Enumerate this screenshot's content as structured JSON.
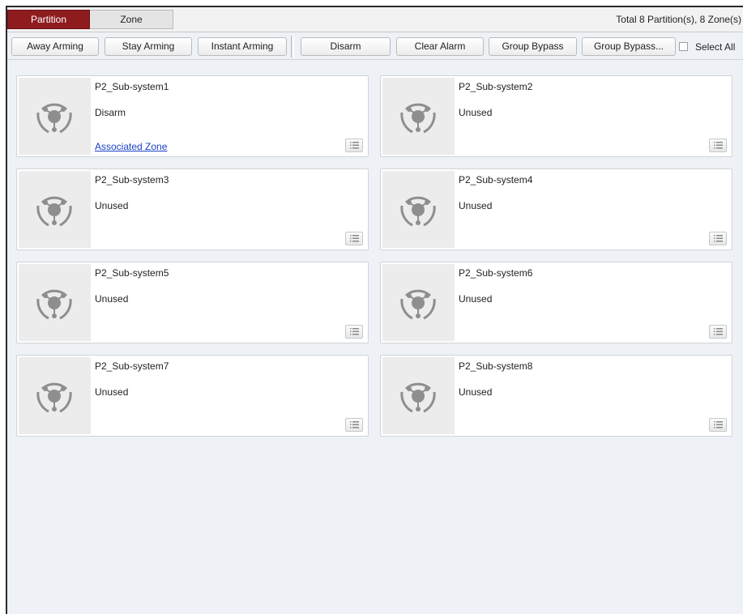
{
  "tabs": [
    {
      "label": "Partition",
      "active": true
    },
    {
      "label": "Zone",
      "active": false
    }
  ],
  "summary": "Total 8 Partition(s), 8 Zone(s)",
  "toolbar": {
    "away_arming": "Away Arming",
    "stay_arming": "Stay Arming",
    "instant_arming": "Instant Arming",
    "disarm": "Disarm",
    "clear_alarm": "Clear Alarm",
    "group_bypass": "Group Bypass",
    "group_bypass_more": "Group Bypass...",
    "select_all": "Select All",
    "select_all_checked": false
  },
  "partitions": [
    {
      "name": "P2_Sub-system1",
      "status": "Disarm",
      "link": "Associated Zone"
    },
    {
      "name": "P2_Sub-system2",
      "status": "Unused"
    },
    {
      "name": "P2_Sub-system3",
      "status": "Unused"
    },
    {
      "name": "P2_Sub-system4",
      "status": "Unused"
    },
    {
      "name": "P2_Sub-system5",
      "status": "Unused"
    },
    {
      "name": "P2_Sub-system6",
      "status": "Unused"
    },
    {
      "name": "P2_Sub-system7",
      "status": "Unused"
    },
    {
      "name": "P2_Sub-system8",
      "status": "Unused"
    }
  ],
  "icons": {
    "partition": "partition-icon",
    "menu": "list-menu-icon"
  },
  "colors": {
    "active_tab": "#8e1c1f",
    "link": "#1a3fc7",
    "background": "#eef1f5"
  }
}
